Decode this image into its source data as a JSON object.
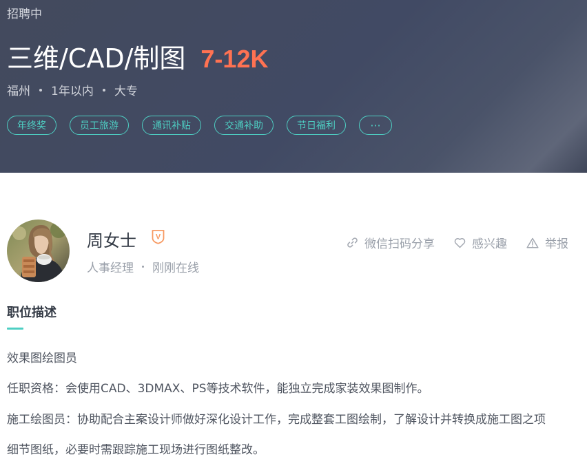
{
  "job": {
    "status": "招聘中",
    "title": "三维/CAD/制图",
    "salary": "7-12K",
    "city": "福州",
    "experience": "1年以内",
    "education": "大专",
    "tags": [
      "年终奖",
      "员工旅游",
      "通讯补贴",
      "交通补助",
      "节日福利"
    ],
    "more_tags_label": "···"
  },
  "recruiter": {
    "name": "周女士",
    "badge_letter": "V",
    "role": "人事经理",
    "online_status": "刚刚在线"
  },
  "actions": {
    "share_label": "微信扫码分享",
    "interest_label": "感兴趣",
    "report_label": "举报"
  },
  "description": {
    "heading": "职位描述",
    "lines": [
      "效果图绘图员",
      "任职资格：会使用CAD、3DMAX、PS等技术软件，能独立完成家装效果图制作。",
      "施工绘图员：协助配合主案设计师做好深化设计工作，完成整套工图绘制，了解设计并转换成施工图之项",
      "细节图纸，必要时需跟踪施工现场进行图纸整改。"
    ]
  },
  "colors": {
    "banner_bg": "#434a5d",
    "salary": "#ff7252",
    "accent_teal": "#4ecfc3",
    "badge_orange": "#f79a62",
    "muted_text": "#9aa0aa"
  },
  "icons": {
    "share": "link-icon",
    "interest": "heart-outline-icon",
    "report": "warning-triangle-icon",
    "verify": "verified-shield-icon"
  }
}
